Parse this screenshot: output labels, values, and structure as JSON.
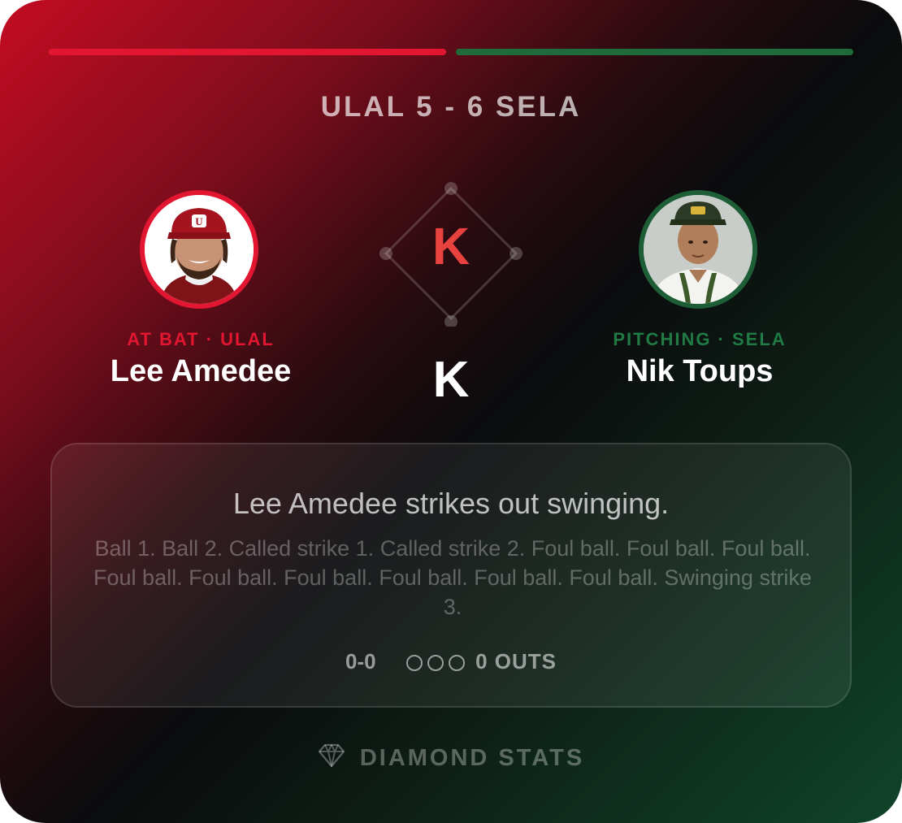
{
  "scoreboard": {
    "text": "ULAL 5 - 6 SELA"
  },
  "colors": {
    "away": "#e31631",
    "home": "#1f6b3b",
    "strikeout": "#e8423f"
  },
  "batter": {
    "role": "AT BAT · ULAL",
    "name": "Lee Amedee"
  },
  "pitcher": {
    "role": "PITCHING · SELA",
    "name": "Nik Toups"
  },
  "diamond": {
    "letter": "K"
  },
  "play": {
    "result": "K",
    "headline": "Lee Amedee strikes out swinging.",
    "description": "Ball 1. Ball 2. Called strike 1. Called strike 2. Foul ball. Foul ball. Foul ball. Foul ball. Foul ball. Foul ball. Foul ball. Foul ball. Foul ball. Swinging strike 3.",
    "count": "0-0",
    "outs_label": "0 OUTS"
  },
  "brand": {
    "name": "DIAMOND STATS",
    "icon": "diamond-icon"
  }
}
